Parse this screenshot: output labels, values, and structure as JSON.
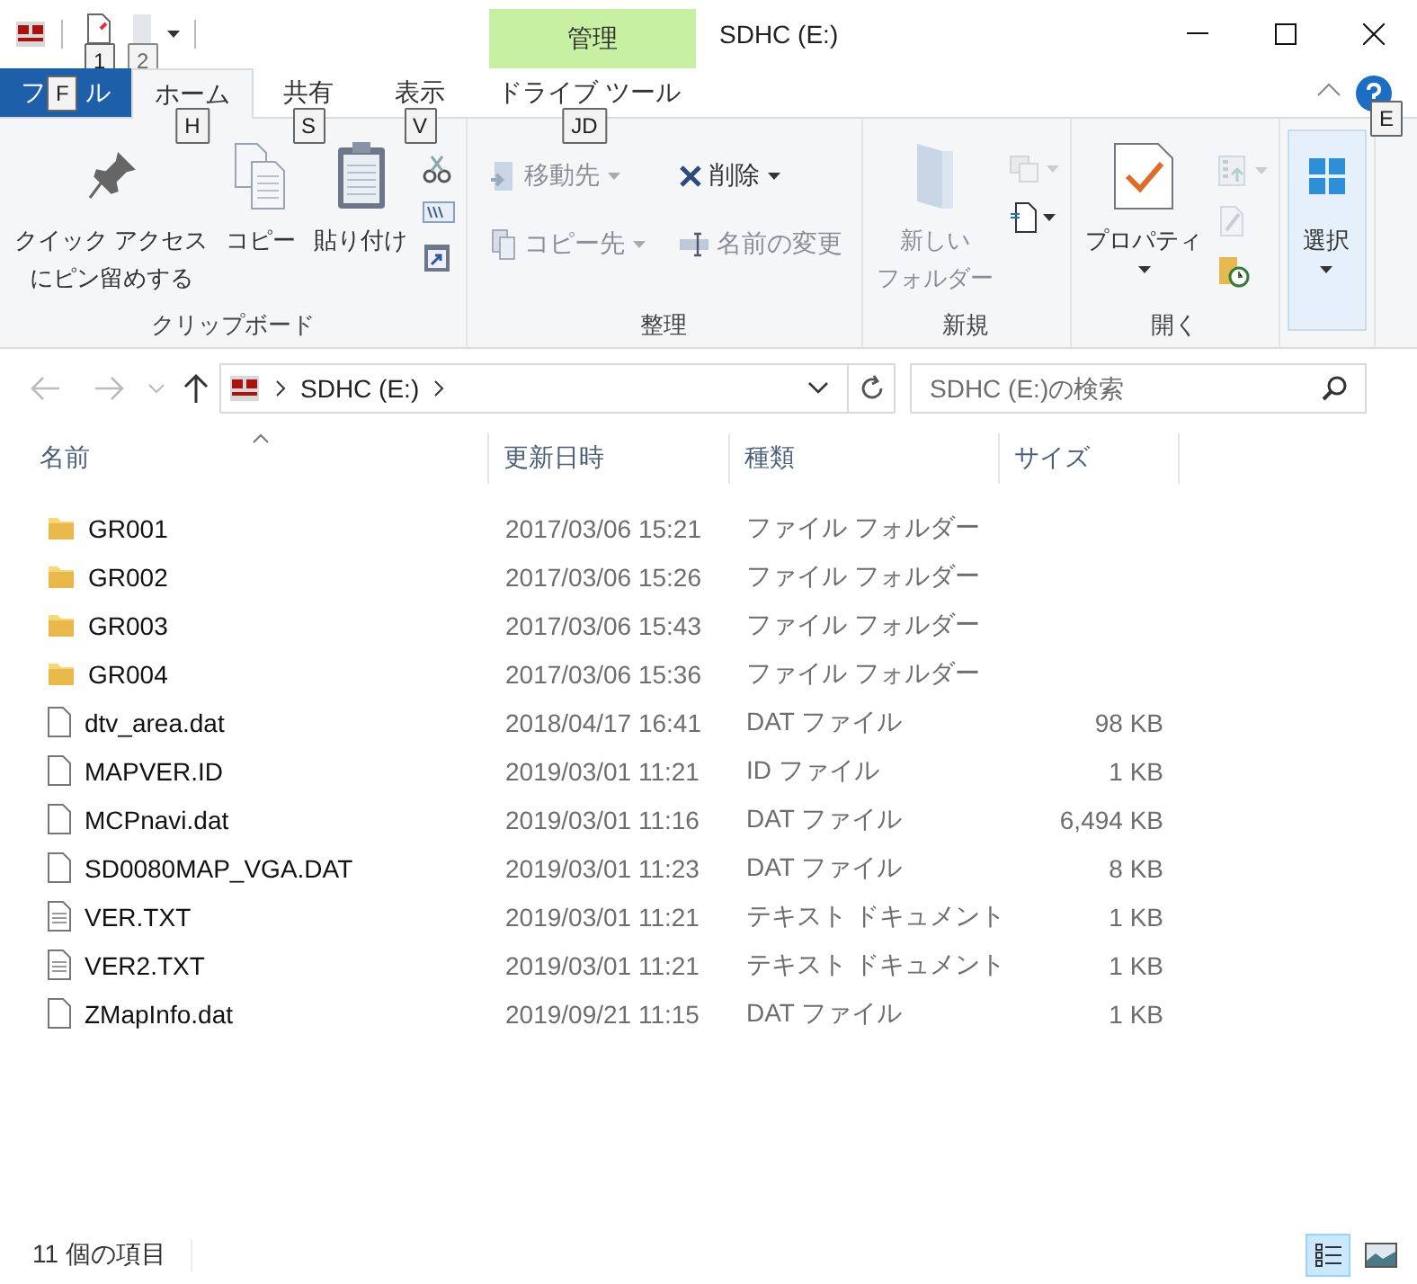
{
  "title_bar": {
    "quick_access": [
      {
        "keytip": "1",
        "disabled": false
      },
      {
        "keytip": "2",
        "disabled": true
      }
    ],
    "context_group": "管理",
    "title": "SDHC (E:)"
  },
  "tabs": [
    {
      "label": "フ",
      "label_end": "ル",
      "kind": "file",
      "keytip": "F",
      "selected": false
    },
    {
      "label": "ホーム",
      "kind": "normal",
      "keytip": "H",
      "selected": true
    },
    {
      "label": "共有",
      "kind": "normal",
      "keytip": "S",
      "selected": false
    },
    {
      "label": "表示",
      "kind": "normal",
      "keytip": "V",
      "selected": false
    },
    {
      "label": "ドライブ ツール",
      "kind": "context",
      "keytip": "JD",
      "selected": false
    }
  ],
  "help_keytip": "E",
  "ribbon": [
    {
      "label": "クリップボード",
      "items": [
        {
          "kind": "large",
          "lines": [
            "クイック アクセス",
            "にピン留めする"
          ],
          "disabled": false,
          "dropdown": false
        },
        {
          "kind": "large",
          "lines": [
            "コピー"
          ],
          "disabled": false,
          "dropdown": false
        },
        {
          "kind": "large",
          "lines": [
            "貼り付け"
          ],
          "disabled": false,
          "dropdown": false
        },
        {
          "kind": "small",
          "disabled": false,
          "dropdown": false
        },
        {
          "kind": "small",
          "disabled": false,
          "dropdown": false
        },
        {
          "kind": "small",
          "disabled": false,
          "dropdown": false
        }
      ]
    },
    {
      "label": "整理",
      "items": [
        {
          "kind": "row",
          "label": "移動先",
          "disabled": true,
          "dropdown": true
        },
        {
          "kind": "row",
          "label": "削除",
          "disabled": false,
          "dropdown": true
        },
        {
          "kind": "row",
          "label": "コピー先",
          "disabled": true,
          "dropdown": true
        },
        {
          "kind": "row",
          "label": "名前の変更",
          "disabled": true,
          "dropdown": false
        }
      ]
    },
    {
      "label": "新規",
      "items": [
        {
          "kind": "large",
          "lines": [
            "新しい",
            "フォルダー"
          ],
          "disabled": true,
          "dropdown": false
        },
        {
          "kind": "small",
          "disabled": true,
          "dropdown": true
        },
        {
          "kind": "small",
          "disabled": false,
          "dropdown": true
        }
      ]
    },
    {
      "label": "開く",
      "items": [
        {
          "kind": "large",
          "lines": [
            "プロパティ"
          ],
          "disabled": false,
          "dropdown": true
        },
        {
          "kind": "small",
          "disabled": true,
          "dropdown": true
        },
        {
          "kind": "small",
          "disabled": true,
          "dropdown": false
        },
        {
          "kind": "small",
          "disabled": false,
          "dropdown": false
        }
      ]
    },
    {
      "items": [
        {
          "kind": "large",
          "lines": [
            "選択"
          ],
          "disabled": false,
          "dropdown": true,
          "pressed": true
        }
      ]
    }
  ],
  "address": {
    "crumbs": [
      "SDHC (E:)"
    ],
    "search_placeholder": "SDHC (E:)の検索"
  },
  "columns": [
    "名前",
    "更新日時",
    "種類",
    "サイズ"
  ],
  "files": [
    {
      "kind": "folder",
      "name": "GR001",
      "modified": "2017/03/06 15:21",
      "type": "ファイル フォルダー"
    },
    {
      "kind": "folder",
      "name": "GR002",
      "modified": "2017/03/06 15:26",
      "type": "ファイル フォルダー"
    },
    {
      "kind": "folder",
      "name": "GR003",
      "modified": "2017/03/06 15:43",
      "type": "ファイル フォルダー"
    },
    {
      "kind": "folder",
      "name": "GR004",
      "modified": "2017/03/06 15:36",
      "type": "ファイル フォルダー"
    },
    {
      "kind": "file",
      "name": "dtv_area.dat",
      "modified": "2018/04/17 16:41",
      "type": "DAT ファイル",
      "size": "98 KB"
    },
    {
      "kind": "file",
      "name": "MAPVER.ID",
      "modified": "2019/03/01 11:21",
      "type": "ID ファイル",
      "size": "1 KB"
    },
    {
      "kind": "file",
      "name": "MCPnavi.dat",
      "modified": "2019/03/01 11:16",
      "type": "DAT ファイル",
      "size": "6,494 KB"
    },
    {
      "kind": "file",
      "name": "SD0080MAP_VGA.DAT",
      "modified": "2019/03/01 11:23",
      "type": "DAT ファイル",
      "size": "8 KB"
    },
    {
      "kind": "text",
      "name": "VER.TXT",
      "modified": "2019/03/01 11:21",
      "type": "テキスト ドキュメント",
      "size": "1 KB"
    },
    {
      "kind": "text",
      "name": "VER2.TXT",
      "modified": "2019/03/01 11:21",
      "type": "テキスト ドキュメント",
      "size": "1 KB"
    },
    {
      "kind": "file",
      "name": "ZMapInfo.dat",
      "modified": "2019/09/21 11:15",
      "type": "DAT ファイル",
      "size": "1 KB"
    }
  ],
  "status": {
    "count": "11 個の項目",
    "views": [
      {
        "selected": true
      },
      {
        "selected": false
      }
    ]
  }
}
